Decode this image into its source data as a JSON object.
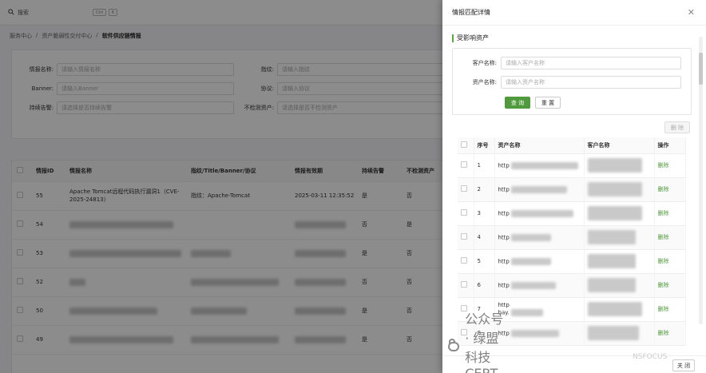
{
  "topbar": {
    "search_label": "搜索",
    "kbd": [
      "Ctrl",
      "K"
    ]
  },
  "breadcrumb": [
    "服务中心",
    "/",
    "资产脆弱性交付中心",
    "/",
    "软件供应链情报"
  ],
  "filters": [
    {
      "label": "情报名称:",
      "placeholder": "请输入情报名称"
    },
    {
      "label": "指纹:",
      "placeholder": "请输入指纹"
    },
    {
      "label": "Banner:",
      "placeholder": "请输入Banner"
    },
    {
      "label": "协议:",
      "placeholder": "请输入协议"
    },
    {
      "label": "持续告警:",
      "placeholder": "请选择是否持续告警"
    },
    {
      "label": "不检测资产:",
      "placeholder": "请选择是否不检测资产"
    }
  ],
  "bg_table": {
    "headers": [
      "情报ID",
      "情报名称",
      "指纹/Title/Banner/协议",
      "情报有效期",
      "持续告警",
      "不检测资产"
    ],
    "rows": [
      {
        "id": "55",
        "name": "Apache Tomcat远程代码执行漏洞1（CVE-2025-24813）",
        "fp": "指纹：Apache-Tomcat",
        "date": "2025-03-11 12:35:52",
        "alert": "是",
        "skip": "否"
      },
      {
        "id": "54",
        "name": "",
        "fp": "",
        "date": "",
        "alert": "否",
        "skip": "是"
      },
      {
        "id": "53",
        "name": "",
        "fp": "",
        "date": "",
        "alert": "是",
        "skip": "否"
      },
      {
        "id": "52",
        "name": "",
        "fp": "",
        "date": "",
        "alert": "否",
        "skip": "否"
      },
      {
        "id": "50",
        "name": "",
        "fp": "",
        "date": "",
        "alert": "是",
        "skip": "否"
      },
      {
        "id": "49",
        "name": "",
        "fp": "",
        "date": "",
        "alert": "是",
        "skip": "否"
      }
    ]
  },
  "drawer": {
    "title": "情报匹配详情",
    "section": "受影响资产",
    "customer_label": "客户名称:",
    "customer_placeholder": "请输入客户名称",
    "asset_label": "资产名称:",
    "asset_placeholder": "请输入资产名称",
    "query_btn": "查 询",
    "reset_btn": "重 置",
    "delete_btn": "删 除",
    "close_btn": "关 闭",
    "table_headers": [
      "序号",
      "资产名称",
      "客户名称",
      "操作"
    ],
    "rows": [
      {
        "no": "1",
        "asset": "http",
        "action": "删除"
      },
      {
        "no": "2",
        "asset": "http",
        "action": "删除"
      },
      {
        "no": "3",
        "asset": "http",
        "action": "删除"
      },
      {
        "no": "4",
        "asset": "http",
        "action": "删除"
      },
      {
        "no": "5",
        "asset": "http",
        "action": "删除"
      },
      {
        "no": "6",
        "asset": "http",
        "action": "删除"
      },
      {
        "no": "7",
        "asset": "http",
        "asset2": "bay.",
        "action": "删除"
      },
      {
        "no": "8",
        "asset": "http",
        "action": "删除"
      }
    ]
  },
  "watermark": {
    "text": "公众号 · 绿盟科技CERT",
    "sub": "NSFOCUS"
  },
  "colors": {
    "accent": "#4f9a3c",
    "overlay": "rgba(0,0,0,0.45)"
  }
}
